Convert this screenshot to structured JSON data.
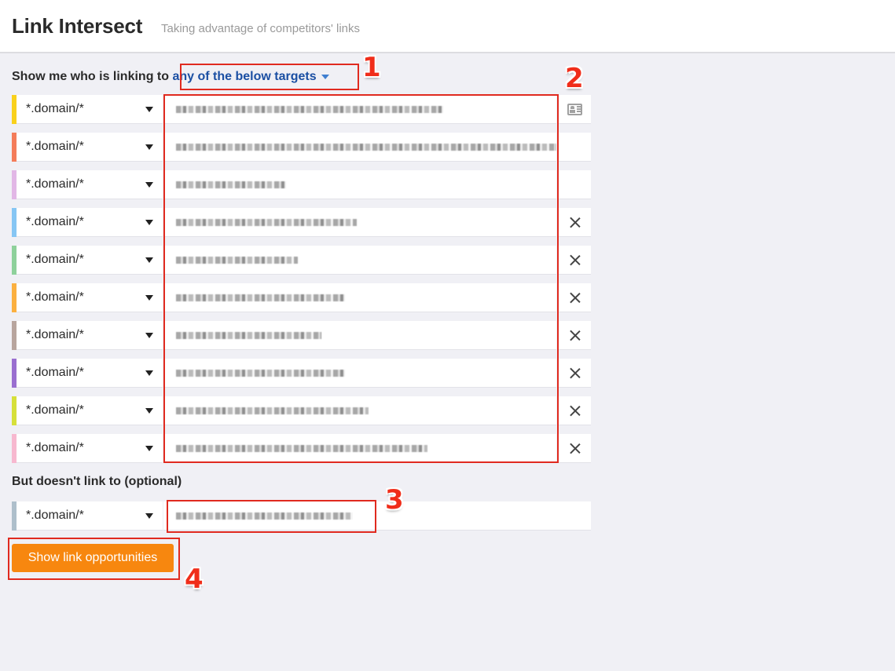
{
  "header": {
    "title": "Link Intersect",
    "subtitle": "Taking advantage of competitors' links"
  },
  "targets_section": {
    "label": "Show me who is linking to",
    "mode_label": "any of the below targets",
    "mode_icon": "caret-down-icon"
  },
  "targets": [
    {
      "mode": "*.domain/*",
      "color": "#f9d11c",
      "url_redacted": true,
      "action": "import-list-icon"
    },
    {
      "mode": "*.domain/*",
      "color": "#f47c5a",
      "url_redacted": true,
      "action": null
    },
    {
      "mode": "*.domain/*",
      "color": "#e2b7e6",
      "url_redacted": true,
      "action": null
    },
    {
      "mode": "*.domain/*",
      "color": "#86c6f4",
      "url_redacted": true,
      "action": "close-icon"
    },
    {
      "mode": "*.domain/*",
      "color": "#8ed19b",
      "url_redacted": true,
      "action": "close-icon"
    },
    {
      "mode": "*.domain/*",
      "color": "#fbb040",
      "url_redacted": true,
      "action": "close-icon"
    },
    {
      "mode": "*.domain/*",
      "color": "#b8a59e",
      "url_redacted": true,
      "action": "close-icon"
    },
    {
      "mode": "*.domain/*",
      "color": "#9a6fd0",
      "url_redacted": true,
      "action": "close-icon"
    },
    {
      "mode": "*.domain/*",
      "color": "#d6e03a",
      "url_redacted": true,
      "action": "close-icon"
    },
    {
      "mode": "*.domain/*",
      "color": "#f7b8cf",
      "url_redacted": true,
      "action": "close-icon"
    }
  ],
  "exclude_section": {
    "label": "But doesn't link to (optional)",
    "mode": "*.domain/*",
    "color": "#aebfcb",
    "url_redacted": true
  },
  "submit": {
    "label": "Show link opportunities",
    "color": "#f7870f"
  },
  "annotations": [
    {
      "number": "1",
      "target": "target-mode-dropdown"
    },
    {
      "number": "2",
      "target": "target-url-inputs"
    },
    {
      "number": "3",
      "target": "exclude-url-input"
    },
    {
      "number": "4",
      "target": "show-link-opportunities-button"
    }
  ]
}
